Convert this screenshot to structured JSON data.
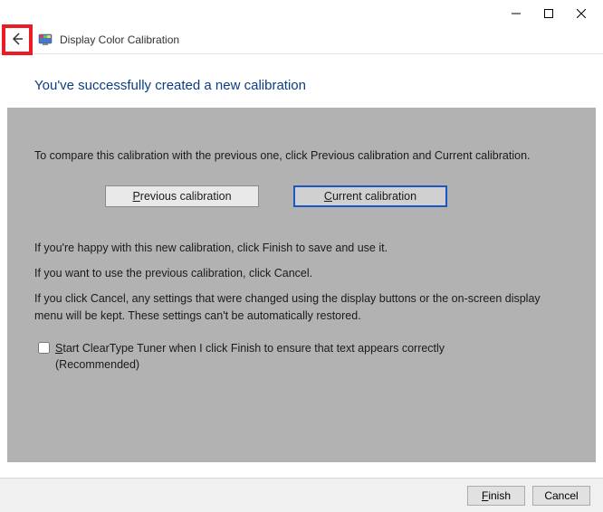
{
  "window": {
    "title": "Display Color Calibration"
  },
  "heading": "You've successfully created a new calibration",
  "body": {
    "compare_intro": "To compare this calibration with the previous one, click Previous calibration and Current calibration.",
    "prev_btn": "Previous calibration",
    "curr_btn": "Current calibration",
    "happy": "If you're happy with this new calibration, click Finish to save and use it.",
    "cancel": "If you want to use the previous calibration, click Cancel.",
    "warn": "If you click Cancel, any settings that were changed using the display buttons or the on-screen display menu will be kept. These settings can't be automatically restored.",
    "cleartype": "Start ClearType Tuner when I click Finish to ensure that text appears correctly (Recommended)"
  },
  "footer": {
    "finish": "Finish",
    "cancel": "Cancel"
  }
}
